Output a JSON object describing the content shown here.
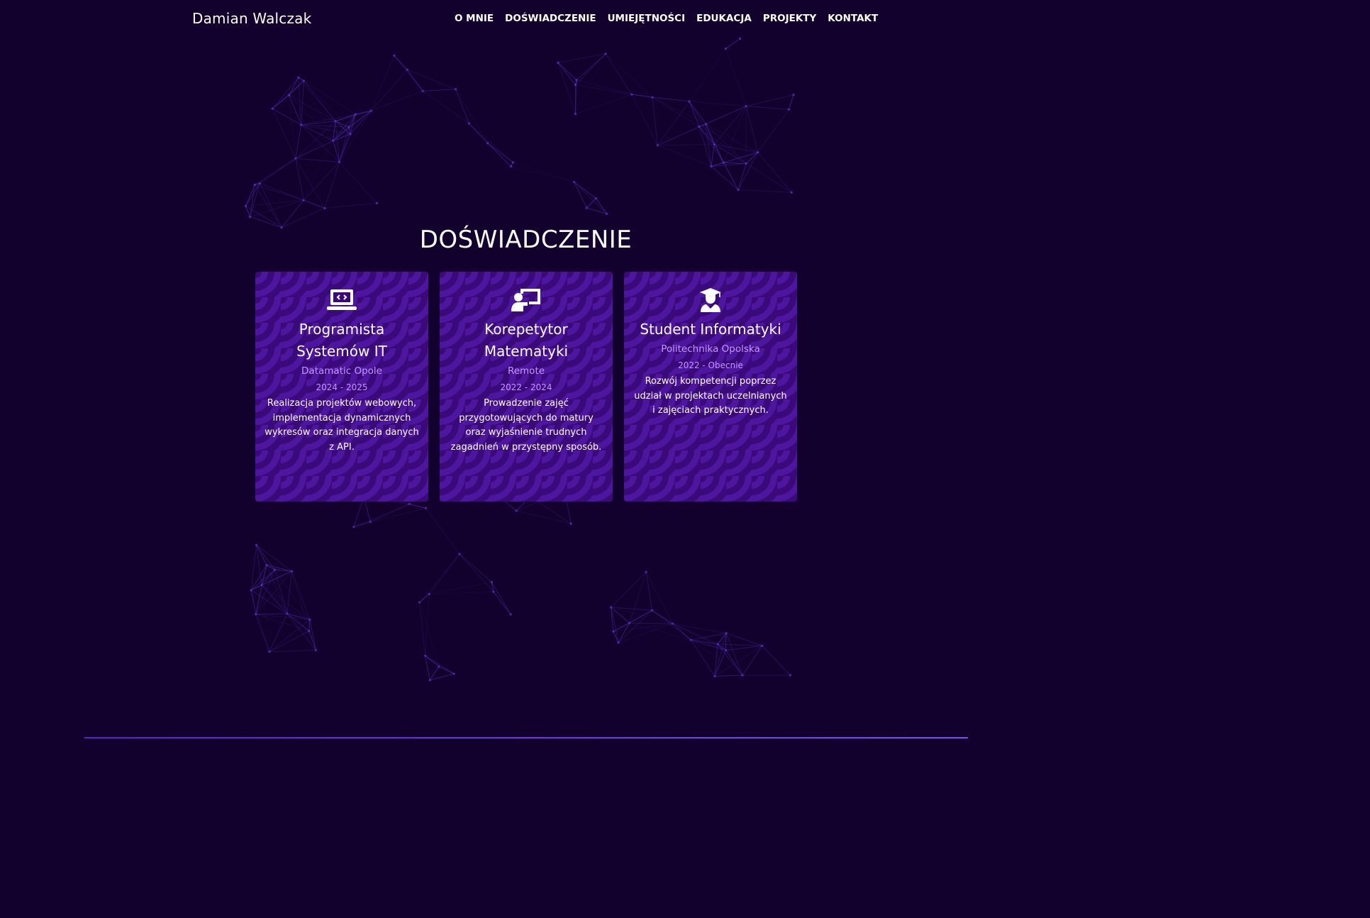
{
  "colors": {
    "background": "#12012c",
    "card": "#3a0b78",
    "card_pattern": "#4e159f",
    "accent_text": "#c596ff",
    "network": "#4b26a0",
    "footer_line": "#6a35e0"
  },
  "navbar": {
    "brand": "Damian Walczak",
    "links": [
      {
        "label": "O MNIE"
      },
      {
        "label": "DOŚWIADCZENIE"
      },
      {
        "label": "UMIEJĘTNOŚCI"
      },
      {
        "label": "EDUKACJA"
      },
      {
        "label": "PROJEKTY"
      },
      {
        "label": "KONTAKT"
      }
    ]
  },
  "experience": {
    "title": "DOŚWIADCZENIE",
    "cards": [
      {
        "icon": "laptop-code-icon",
        "title": "Programista Systemów IT",
        "company": "Datamatic Opole",
        "dates": "2024 - 2025",
        "description": "Realizacja projektów webowych, implementacja dynamicznych wykresów oraz integracja danych z API."
      },
      {
        "icon": "chalkboard-teacher-icon",
        "title": "Korepetytor Matematyki",
        "company": "Remote",
        "dates": "2022 - 2024",
        "description": "Prowadzenie zajęć przygotowujących do matury oraz wyjaśnienie trudnych zagadnień w przystępny sposób."
      },
      {
        "icon": "graduate-user-icon",
        "title": "Student Informatyki",
        "company": "Politechnika Opolska",
        "dates": "2022 - Obecnie",
        "description": "Rozwój kompetencji poprzez udział w projektach uczelnianych i zajęciach praktycznych."
      }
    ]
  }
}
